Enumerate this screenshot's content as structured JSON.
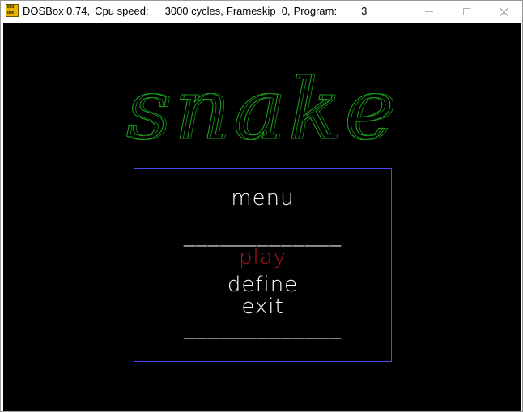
{
  "window": {
    "icon_line1": "DOS",
    "icon_line2": "BOX",
    "app_name": "DOSBox 0.74,",
    "speed_label": "Cpu speed:",
    "cycles": "3000 cycles,",
    "frameskip": "Frameskip  0,",
    "program_label": "Program:",
    "program_value": "3"
  },
  "game": {
    "logo_text": "snake",
    "menu": {
      "heading": "menu",
      "separator": "_____________",
      "items": [
        "play",
        "define",
        "exit"
      ],
      "selected_index": 0
    }
  },
  "colors": {
    "background": "#000000",
    "logo": "#1fa81f",
    "menu_text": "#ffffff",
    "selected": "#b01515",
    "frame": "#4a4af0"
  }
}
